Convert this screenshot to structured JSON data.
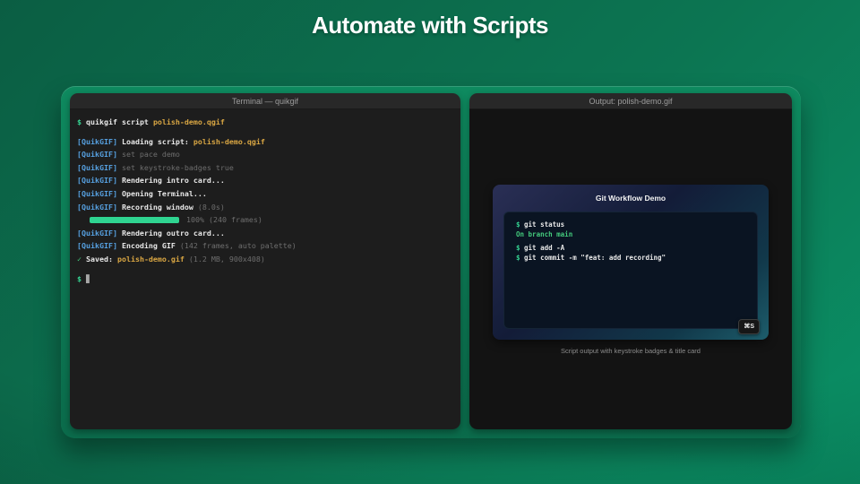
{
  "page": {
    "title": "Automate with Scripts"
  },
  "terminal_window": {
    "title": "Terminal — quikgif",
    "lines": [
      {
        "segments": [
          {
            "t": "$ ",
            "c": "prompt"
          },
          {
            "t": "quikgif script ",
            "c": "text"
          },
          {
            "t": "polish-demo.qgif",
            "c": "file"
          }
        ]
      },
      {
        "type": "gap"
      },
      {
        "segments": [
          {
            "t": "[QuikGIF] ",
            "c": "tag"
          },
          {
            "t": "Loading script: ",
            "c": "text"
          },
          {
            "t": "polish-demo.qgif",
            "c": "file"
          }
        ]
      },
      {
        "segments": [
          {
            "t": "[QuikGIF] ",
            "c": "tag"
          },
          {
            "t": "set pace demo",
            "c": "muted"
          }
        ]
      },
      {
        "segments": [
          {
            "t": "[QuikGIF] ",
            "c": "tag"
          },
          {
            "t": "set keystroke-badges true",
            "c": "muted"
          }
        ]
      },
      {
        "segments": [
          {
            "t": "[QuikGIF] ",
            "c": "tag"
          },
          {
            "t": "Rendering intro card...",
            "c": "text"
          }
        ]
      },
      {
        "segments": [
          {
            "t": "[QuikGIF] ",
            "c": "tag"
          },
          {
            "t": "Opening Terminal...",
            "c": "text"
          }
        ]
      },
      {
        "segments": [
          {
            "t": "[QuikGIF] ",
            "c": "tag"
          },
          {
            "t": "Recording window ",
            "c": "text"
          },
          {
            "t": "(8.0s)",
            "c": "dim"
          }
        ]
      },
      {
        "type": "progress",
        "percent": 100,
        "label": "100% (240 frames)"
      },
      {
        "segments": [
          {
            "t": "[QuikGIF] ",
            "c": "tag"
          },
          {
            "t": "Rendering outro card...",
            "c": "text"
          }
        ]
      },
      {
        "segments": [
          {
            "t": "[QuikGIF] ",
            "c": "tag"
          },
          {
            "t": "Encoding GIF ",
            "c": "text"
          },
          {
            "t": "(142 frames, auto palette)",
            "c": "dim"
          }
        ]
      },
      {
        "segments": [
          {
            "t": "✓ ",
            "c": "success"
          },
          {
            "t": "Saved: ",
            "c": "text"
          },
          {
            "t": "polish-demo.gif ",
            "c": "file"
          },
          {
            "t": "(1.2 MB, 900x408)",
            "c": "dim"
          }
        ]
      },
      {
        "type": "gap"
      },
      {
        "segments": [
          {
            "t": "$ ",
            "c": "prompt"
          },
          {
            "t": "▊",
            "c": "cursor"
          }
        ]
      }
    ]
  },
  "output_window": {
    "title": "Output: polish-demo.gif",
    "gif": {
      "title": "Git Workflow Demo",
      "badge": "⌘S",
      "lines": [
        {
          "segments": [
            {
              "t": "$ ",
              "c": "prompt"
            },
            {
              "t": "git status",
              "c": "text"
            }
          ]
        },
        {
          "segments": [
            {
              "t": "On branch main",
              "c": "success"
            }
          ]
        },
        {
          "type": "gap"
        },
        {
          "segments": [
            {
              "t": "$ ",
              "c": "prompt"
            },
            {
              "t": "git add -A",
              "c": "text"
            }
          ]
        },
        {
          "segments": [
            {
              "t": "$ ",
              "c": "prompt"
            },
            {
              "t": "git commit -m \"feat: add recording\"",
              "c": "text"
            }
          ]
        }
      ]
    },
    "caption": "Script output with keystroke badges & title card"
  },
  "colors": {
    "background_top": "#0b5e43",
    "background_bottom": "#0a9166",
    "panel_green_top": "#0e8a5f",
    "panel_green_bottom": "#0b6b4b",
    "titlebar": "#282828",
    "terminal_bg": "#1d1d1d",
    "output_bg": "#131313",
    "tag_blue": "#56a0e0",
    "file_yellow": "#d9a643",
    "prompt_green": "#35d392",
    "success_green": "#43c97c",
    "progress_green": "#2fd491",
    "dim_gray": "#6e6e6e",
    "text_light": "#e8e8e8",
    "card_navy": "#2a2f55",
    "card_teal": "#1d5d6b",
    "gif_terminal_bg": "#0a1422"
  }
}
